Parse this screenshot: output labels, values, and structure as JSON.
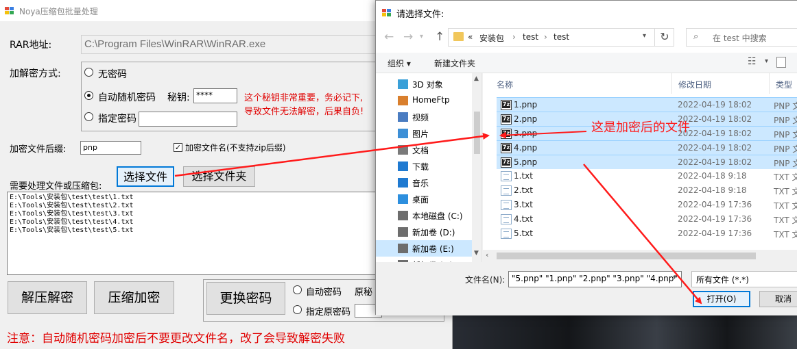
{
  "colors": {
    "accent_red": "#e00000",
    "arrow_red": "#ff1a1a",
    "selection": "#cce8ff",
    "focus_blue": "#0078d7"
  },
  "main_window": {
    "title": "Noya压缩包批量处理",
    "rar_label": "RAR地址:",
    "rar_path": "C:\\Program Files\\WinRAR\\WinRAR.exe",
    "mode_label": "加解密方式:",
    "radio_none": "无密码",
    "radio_auto": "自动随机密码",
    "secret_label": "秘钥:",
    "secret_value": "****",
    "radio_manual": "指定密码",
    "manual_value": "",
    "warning_line1": "这个秘钥非常重要，务必记下,",
    "warning_line2": "导致文件无法解密，后果自负!",
    "suffix_label": "加密文件后缀:",
    "suffix_value": "pnp",
    "encrypt_name_label": "加密文件名(不支持zip后缀)",
    "encrypt_name_checked": true,
    "files_label": "需要处理文件或压缩包:",
    "select_file_btn": "选择文件",
    "select_folder_btn": "选择文件夹",
    "file_paths": [
      "E:\\Tools\\安装包\\test\\test\\1.txt",
      "E:\\Tools\\安装包\\test\\test\\2.txt",
      "E:\\Tools\\安装包\\test\\test\\3.txt",
      "E:\\Tools\\安装包\\test\\test\\4.txt",
      "E:\\Tools\\安装包\\test\\test\\5.txt"
    ],
    "decrypt_btn": "解压解密",
    "encrypt_btn": "压缩加密",
    "change_pwd_btn": "更换密码",
    "radio_auto_pwd": "自动密码",
    "orig_secret_label": "原秘",
    "radio_specify_orig": "指定原密码",
    "note": "注意：自动随机密码加密后不要更改文件名，改了会导致解密失败"
  },
  "dialog": {
    "title": "请选择文件:",
    "breadcrumb": [
      "«",
      "安装包",
      "›",
      "test",
      "›",
      "test"
    ],
    "search_placeholder": "在 test 中搜索",
    "toolbar": {
      "organize": "组织 ▾",
      "new_folder": "新建文件夹"
    },
    "nav_items": [
      {
        "name": "3D 对象",
        "icon": "3d-objects-icon"
      },
      {
        "name": "HomeFtp",
        "icon": "homeftp-icon"
      },
      {
        "name": "视频",
        "icon": "videos-icon"
      },
      {
        "name": "图片",
        "icon": "pictures-icon"
      },
      {
        "name": "文档",
        "icon": "documents-icon"
      },
      {
        "name": "下载",
        "icon": "downloads-icon"
      },
      {
        "name": "音乐",
        "icon": "music-icon"
      },
      {
        "name": "桌面",
        "icon": "desktop-icon"
      },
      {
        "name": "本地磁盘 (C:)",
        "icon": "drive-c-icon"
      },
      {
        "name": "新加卷 (D:)",
        "icon": "drive-d-icon"
      },
      {
        "name": "新加卷 (E:)",
        "icon": "drive-e-icon"
      },
      {
        "name": "新加卷 (F:)",
        "icon": "drive-f-icon"
      }
    ],
    "columns": {
      "name": "名称",
      "date": "修改日期",
      "type": "类型"
    },
    "files": [
      {
        "name": "1.pnp",
        "date": "2022-04-19 18:02",
        "type": "PNP 文",
        "selected": true,
        "kind": "7z"
      },
      {
        "name": "2.pnp",
        "date": "2022-04-19 18:02",
        "type": "PNP 文",
        "selected": true,
        "kind": "7z"
      },
      {
        "name": "3.pnp",
        "date": "2022-04-19 18:02",
        "type": "PNP 文",
        "selected": true,
        "kind": "7z"
      },
      {
        "name": "4.pnp",
        "date": "2022-04-19 18:02",
        "type": "PNP 文",
        "selected": true,
        "kind": "7z"
      },
      {
        "name": "5.pnp",
        "date": "2022-04-19 18:02",
        "type": "PNP 文",
        "selected": true,
        "kind": "7z"
      },
      {
        "name": "1.txt",
        "date": "2022-04-18 9:18",
        "type": "TXT 文",
        "selected": false,
        "kind": "txt"
      },
      {
        "name": "2.txt",
        "date": "2022-04-18 9:18",
        "type": "TXT 文",
        "selected": false,
        "kind": "txt"
      },
      {
        "name": "3.txt",
        "date": "2022-04-19 17:36",
        "type": "TXT 文",
        "selected": false,
        "kind": "txt"
      },
      {
        "name": "4.txt",
        "date": "2022-04-19 17:36",
        "type": "TXT 文",
        "selected": false,
        "kind": "txt"
      },
      {
        "name": "5.txt",
        "date": "2022-04-19 17:36",
        "type": "TXT 文",
        "selected": false,
        "kind": "txt"
      }
    ],
    "filename_label": "文件名(N):",
    "filename_value": "\"5.pnp\" \"1.pnp\" \"2.pnp\" \"3.pnp\" \"4.pnp\"",
    "filetype_value": "所有文件 (*.*)",
    "open_btn": "打开(O)",
    "cancel_btn": "取消"
  },
  "annotation": {
    "text": "这是加密后的文件"
  }
}
